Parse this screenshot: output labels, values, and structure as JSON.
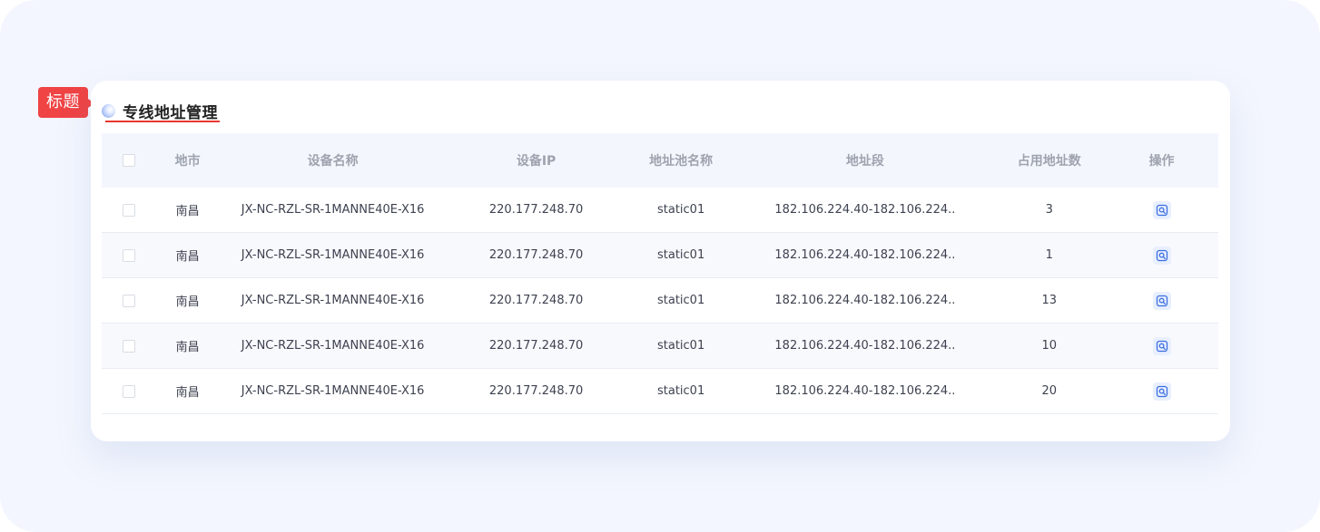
{
  "annotation": {
    "label": "标题"
  },
  "section": {
    "title": "专线地址管理"
  },
  "table": {
    "headers": {
      "city": "地市",
      "device_name": "设备名称",
      "device_ip": "设备IP",
      "pool_name": "地址池名称",
      "segment": "地址段",
      "used_count": "占用地址数",
      "action": "操作"
    },
    "rows": [
      {
        "city": "南昌",
        "device_name": "JX-NC-RZL-SR-1MANNE40E-X16",
        "device_ip": "220.177.248.70",
        "pool_name": "static01",
        "segment": "182.106.224.40-182.106.224..",
        "used_count": "3"
      },
      {
        "city": "南昌",
        "device_name": "JX-NC-RZL-SR-1MANNE40E-X16",
        "device_ip": "220.177.248.70",
        "pool_name": "static01",
        "segment": "182.106.224.40-182.106.224..",
        "used_count": "1"
      },
      {
        "city": "南昌",
        "device_name": "JX-NC-RZL-SR-1MANNE40E-X16",
        "device_ip": "220.177.248.70",
        "pool_name": "static01",
        "segment": "182.106.224.40-182.106.224..",
        "used_count": "13"
      },
      {
        "city": "南昌",
        "device_name": "JX-NC-RZL-SR-1MANNE40E-X16",
        "device_ip": "220.177.248.70",
        "pool_name": "static01",
        "segment": "182.106.224.40-182.106.224..",
        "used_count": "10"
      },
      {
        "city": "南昌",
        "device_name": "JX-NC-RZL-SR-1MANNE40E-X16",
        "device_ip": "220.177.248.70",
        "pool_name": "static01",
        "segment": "182.106.224.40-182.106.224..",
        "used_count": "20"
      }
    ],
    "row_action_icon": "view-detail-icon"
  },
  "colors": {
    "accent": "#ef4344",
    "underline": "#e8362f",
    "header_bg": "#f3f6fd",
    "icon_blue": "#3d6fe0",
    "page_bg": "#f3f6fe"
  }
}
